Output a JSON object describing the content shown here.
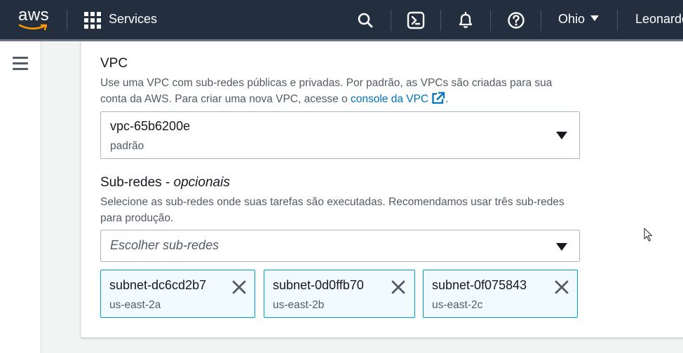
{
  "topnav": {
    "logo_text": "aws",
    "services_label": "Services",
    "region_label": "Ohio",
    "user_label": "Leonardo"
  },
  "vpc": {
    "label": "VPC",
    "description_text": "Use uma VPC com sub-redes públicas e privadas. Por padrão, as VPCs são criadas para sua conta da AWS. Para criar uma nova VPC, acesse o",
    "description_link": "console da VPC",
    "description_end": ".",
    "selected_value": "vpc-65b6200e",
    "selected_sub": "padrão"
  },
  "subnets": {
    "label_main": "Sub-redes - ",
    "label_optional": "opcionais",
    "description": "Selecione as sub-redes onde suas tarefas são executadas. Recomendamos usar três sub-redes para produção.",
    "placeholder": "Escolher sub-redes",
    "tokens": [
      {
        "name": "subnet-dc6cd2b7",
        "zone": "us-east-2a"
      },
      {
        "name": "subnet-0d0ffb70",
        "zone": "us-east-2b"
      },
      {
        "name": "subnet-0f075843",
        "zone": "us-east-2c"
      }
    ]
  },
  "colors": {
    "nav_bg": "#232f3e",
    "link": "#0073bb",
    "token_border": "#00a1c9",
    "token_bg": "#f1faff",
    "aws_smile": "#ff9900"
  }
}
